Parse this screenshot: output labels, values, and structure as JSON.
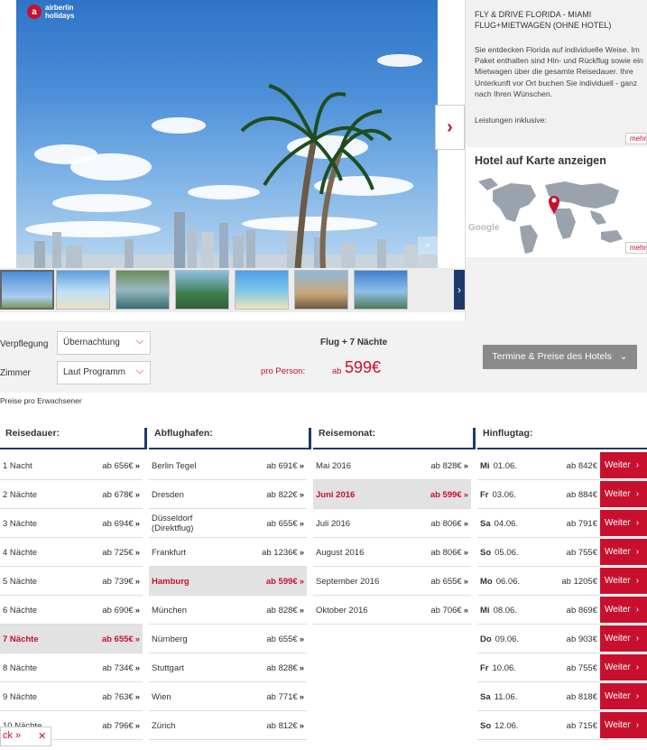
{
  "hero": {
    "logo_line1": "airberlin",
    "logo_line2": "holidays",
    "zoom_icon": "magnifier-icon"
  },
  "info": {
    "title_line1": "FLY & DRIVE FLORIDA - MIAMI",
    "title_line2": "FLUG+MIETWAGEN (OHNE HOTEL)",
    "body": "Sie entdecken Florida auf individuelle Weise. Im Paket enthalten sind Hin- und Rückflug sowie ein Mietwagen über die gesamte Reisedauer. Ihre Unterkunft vor Ort buchen Sie individuell - ganz nach Ihren Wünschen.",
    "leistungen": "Leistungen inklusive:",
    "mehr": "mehr",
    "map_title": "Hotel auf Karte anzeigen",
    "google": "Google"
  },
  "options": {
    "verpflegung_label": "Verpflegung",
    "verpflegung_value": "Übernachtung",
    "zimmer_label": "Zimmer",
    "zimmer_value": "Laut Programm",
    "flug_label": "Flug + 7 Nächte",
    "pro_person": "pro Person:",
    "ab": "ab",
    "price": "599€",
    "termine_button": "Termine & Preise des Hotels",
    "preise_note": "Preise pro Erwachsener"
  },
  "columns": {
    "reisedauer": "Reisedauer:",
    "abflughafen": "Abflughafen:",
    "reisemonat": "Reisemonat:",
    "hinflugtag": "Hinflugtag:"
  },
  "reisedauer": [
    {
      "label": "1 Nacht",
      "price": "ab 656€"
    },
    {
      "label": "2 Nächte",
      "price": "ab 678€"
    },
    {
      "label": "3 Nächte",
      "price": "ab 694€"
    },
    {
      "label": "4 Nächte",
      "price": "ab 725€"
    },
    {
      "label": "5 Nächte",
      "price": "ab 739€"
    },
    {
      "label": "6 Nächte",
      "price": "ab 690€"
    },
    {
      "label": "7 Nächte",
      "price": "ab 655€"
    },
    {
      "label": "8 Nächte",
      "price": "ab 734€"
    },
    {
      "label": "9 Nächte",
      "price": "ab 763€"
    },
    {
      "label": "10 Nächte",
      "price": "ab 796€"
    }
  ],
  "abflughafen": [
    {
      "label": "Berlin Tegel",
      "price": "ab 691€"
    },
    {
      "label": "Dresden",
      "price": "ab 822€"
    },
    {
      "label": "Düsseldorf",
      "label2": "(Direktflug)",
      "price": "ab 655€"
    },
    {
      "label": "Frankfurt",
      "price": "ab 1236€"
    },
    {
      "label": "Hamburg",
      "price": "ab 599€"
    },
    {
      "label": "München",
      "price": "ab 828€"
    },
    {
      "label": "Nürnberg",
      "price": "ab 655€"
    },
    {
      "label": "Stuttgart",
      "price": "ab 828€"
    },
    {
      "label": "Wien",
      "price": "ab 771€"
    },
    {
      "label": "Zürich",
      "price": "ab 812€"
    }
  ],
  "reisemonat": [
    {
      "label": "Mai 2016",
      "price": "ab 828€"
    },
    {
      "label": "Juni 2016",
      "price": "ab 599€"
    },
    {
      "label": "Juli 2016",
      "price": "ab 806€"
    },
    {
      "label": "August 2016",
      "price": "ab 806€"
    },
    {
      "label": "September 2016",
      "price": "ab 655€"
    },
    {
      "label": "Oktober 2016",
      "price": "ab 706€"
    }
  ],
  "hinflugtag": [
    {
      "day": "Mi",
      "date": "01.06.",
      "price": "ab 842€"
    },
    {
      "day": "Fr",
      "date": "03.06.",
      "price": "ab 884€"
    },
    {
      "day": "Sa",
      "date": "04.06.",
      "price": "ab 791€"
    },
    {
      "day": "So",
      "date": "05.06.",
      "price": "ab 755€"
    },
    {
      "day": "Mo",
      "date": "06.06.",
      "price": "ab 1205€"
    },
    {
      "day": "Mi",
      "date": "08.06.",
      "price": "ab 869€"
    },
    {
      "day": "Do",
      "date": "09.06.",
      "price": "ab 903€"
    },
    {
      "day": "Fr",
      "date": "10.06.",
      "price": "ab 755€"
    },
    {
      "day": "Sa",
      "date": "11.06.",
      "price": "ab 818€"
    },
    {
      "day": "So",
      "date": "12.06.",
      "price": "ab 715€"
    }
  ],
  "weiter_label": "Weiter",
  "arrow": "»",
  "chev": "›",
  "footer": {
    "left": "ck »",
    "close": "✕"
  },
  "colors": {
    "accent": "#c8102e",
    "navy": "#1e3a6a",
    "grey_button": "#8a8a8a"
  }
}
